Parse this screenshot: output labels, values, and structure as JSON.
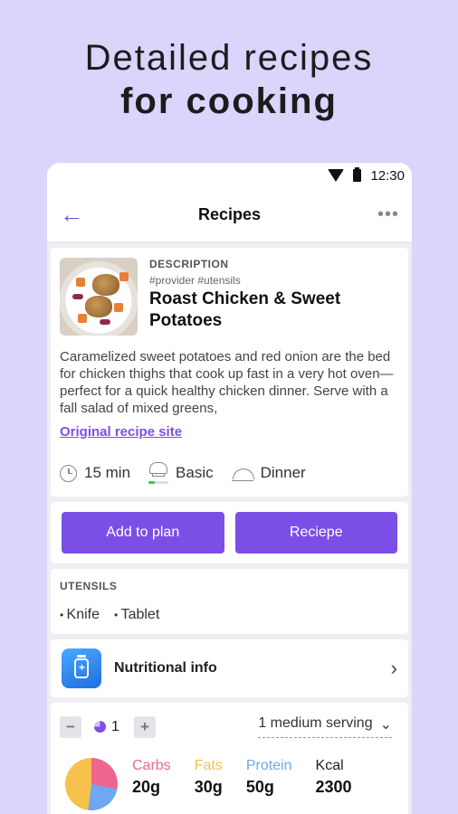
{
  "headline": {
    "line1": "Detailed recipes",
    "line2": "for cooking"
  },
  "status": {
    "time": "12:30"
  },
  "appbar": {
    "back": "←",
    "title": "Recipes",
    "more": "•••"
  },
  "recipe": {
    "kicker": "DESCRIPTION",
    "tags": "#provider #utensils",
    "name": "Roast Chicken & Sweet Potatoes",
    "description": "Caramelized sweet potatoes and red onion are the bed for chicken thighs that cook up fast in a very hot oven—perfect for a quick healthy chicken dinner. Serve with a fall salad of mixed greens,",
    "link": "Original recipe site",
    "time": "15 min",
    "difficulty": "Basic",
    "difficulty_level": 0.33,
    "meal": "Dinner"
  },
  "actions": {
    "add_to_plan": "Add to plan",
    "recipe": "Reciepe"
  },
  "utensils": {
    "label": "UTENSILS",
    "items": [
      "Knife",
      "Tablet"
    ]
  },
  "nutrition": {
    "label": "Nutritional info",
    "chevron": "›"
  },
  "serving": {
    "minus": "−",
    "plus": "+",
    "quantity": "1",
    "size": "1 medium serving",
    "dropdown_icon": "⌄",
    "macros": [
      {
        "label": "Carbs",
        "value": "20g",
        "color": "#F0658E"
      },
      {
        "label": "Fats",
        "value": "30g",
        "color": "#F6C14D"
      },
      {
        "label": "Protein",
        "value": "50g",
        "color": "#6FA8F0"
      },
      {
        "label": "Kcal",
        "value": "2300",
        "color": "#222222"
      }
    ]
  },
  "colors": {
    "accent": "#7B4FE6",
    "background": "#DCD4FB",
    "level": "#3BC45B"
  }
}
